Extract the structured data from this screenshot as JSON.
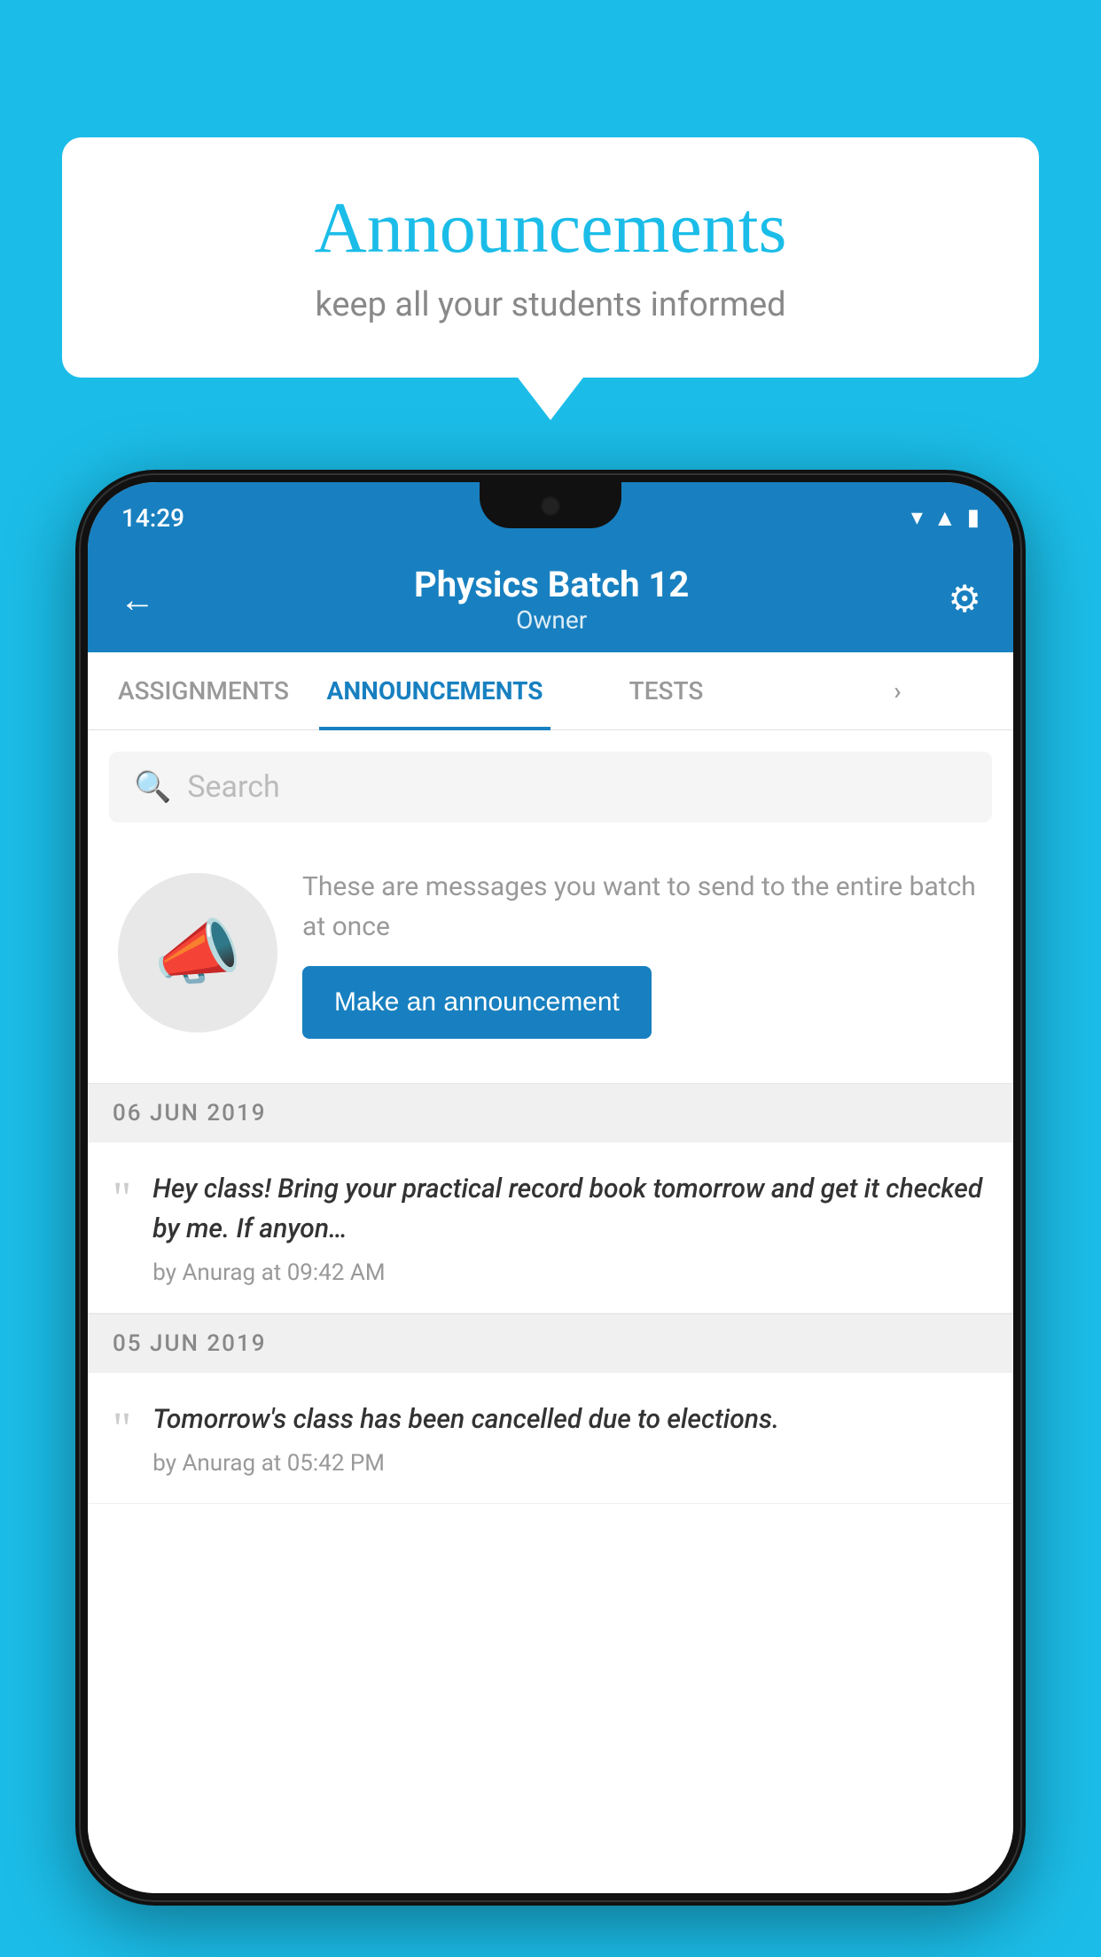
{
  "bubble": {
    "title": "Announcements",
    "subtitle": "keep all your students informed"
  },
  "statusBar": {
    "time": "14:29",
    "icons": [
      "wifi",
      "signal",
      "battery"
    ]
  },
  "header": {
    "title": "Physics Batch 12",
    "subtitle": "Owner",
    "backLabel": "←"
  },
  "tabs": [
    {
      "id": "assignments",
      "label": "ASSIGNMENTS",
      "active": false
    },
    {
      "id": "announcements",
      "label": "ANNOUNCEMENTS",
      "active": true
    },
    {
      "id": "tests",
      "label": "TESTS",
      "active": false
    },
    {
      "id": "more",
      "label": "›",
      "active": false
    }
  ],
  "search": {
    "placeholder": "Search"
  },
  "placeholder": {
    "hint": "These are messages you want to send to the entire batch at once",
    "buttonLabel": "Make an announcement"
  },
  "announcements": [
    {
      "date": "06  JUN  2019",
      "message": "Hey class! Bring your practical record book tomorrow and get it checked by me. If anyon…",
      "meta": "by Anurag at 09:42 AM"
    },
    {
      "date": "05  JUN  2019",
      "message": "Tomorrow's class has been cancelled due to elections.",
      "meta": "by Anurag at 05:42 PM"
    }
  ]
}
